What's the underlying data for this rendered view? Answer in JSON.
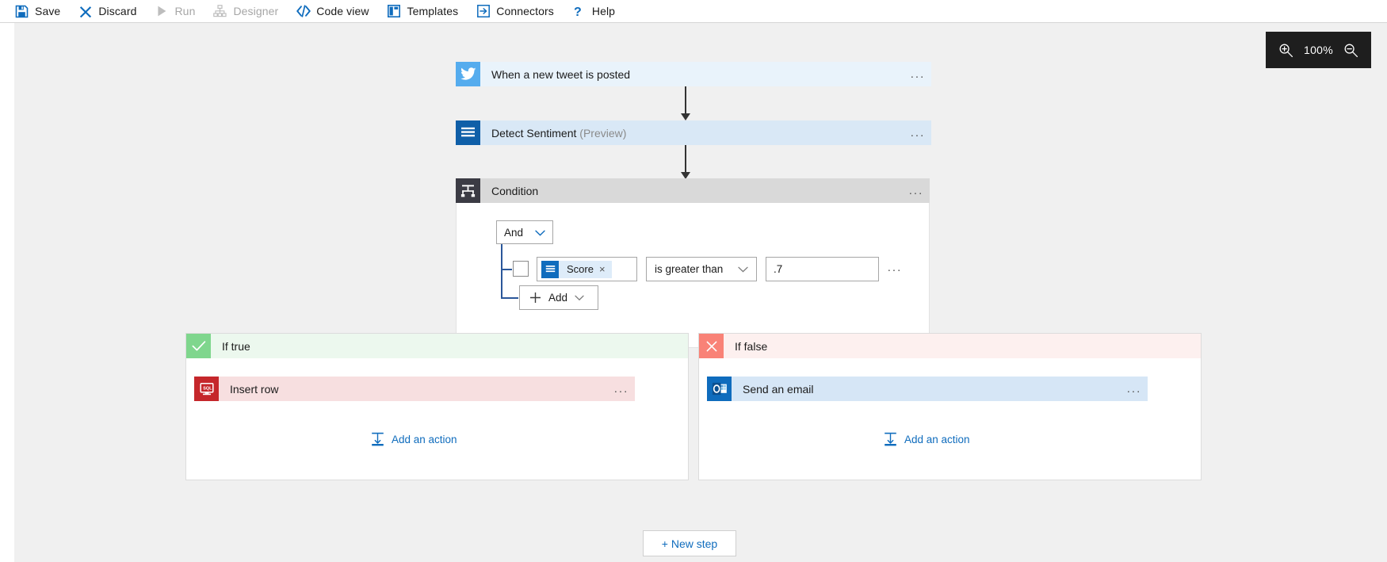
{
  "toolbar": {
    "items": [
      {
        "label": "Save",
        "icon": "save-icon",
        "disabled": false
      },
      {
        "label": "Discard",
        "icon": "discard-icon",
        "disabled": false
      },
      {
        "label": "Run",
        "icon": "run-icon",
        "disabled": true
      },
      {
        "label": "Designer",
        "icon": "designer-icon",
        "disabled": true
      },
      {
        "label": "Code view",
        "icon": "code-view-icon",
        "disabled": false
      },
      {
        "label": "Templates",
        "icon": "templates-icon",
        "disabled": false
      },
      {
        "label": "Connectors",
        "icon": "connectors-icon",
        "disabled": false
      },
      {
        "label": "Help",
        "icon": "help-icon",
        "disabled": false
      }
    ]
  },
  "zoom_control": {
    "zoom_in_icon": "zoom-in-icon",
    "level": "100%",
    "zoom_out_icon": "zoom-out-icon",
    "background": "#1e1e1e"
  },
  "flow": {
    "trigger": {
      "title": "When a new tweet is posted",
      "icon": "twitter-icon",
      "icon_color": "#55acee",
      "card_color": "#e9f3fb",
      "overflow": "..."
    },
    "action": {
      "title": "Detect Sentiment",
      "suffix": "(Preview)",
      "icon": "text-analytics-icon",
      "icon_color": "#0f5fa8",
      "card_color": "#d9e8f6",
      "overflow": "..."
    },
    "condition": {
      "title": "Condition",
      "icon": "condition-icon",
      "icon_color": "#3b3b44",
      "header_color": "#d9d9d9",
      "overflow": "...",
      "logic_operator": "And",
      "row": {
        "token_label": "Score",
        "token_icon": "text-analytics-token-icon",
        "token_remove": "×",
        "operator": "is greater than",
        "value": ".7",
        "row_overflow": "..."
      },
      "add_label": "Add"
    },
    "branches": [
      {
        "name": "if-true",
        "label": "If true",
        "tile_color": "#7fd68d",
        "header_color": "#ecf8ee",
        "status_icon": "check-icon",
        "action": {
          "title": "Insert row",
          "icon": "sql-icon",
          "icon_color": "#c5272b",
          "card_color": "#f7dfe0",
          "overflow": "..."
        },
        "add_action_label": "Add an action",
        "add_action_icon": "insert-action-icon"
      },
      {
        "name": "if-false",
        "label": "If false",
        "tile_color": "#f98277",
        "header_color": "#fdf0ef",
        "status_icon": "cross-icon",
        "action": {
          "title": "Send an email",
          "icon": "outlook-icon",
          "icon_color": "#0f6cbd",
          "card_color": "#d6e6f6",
          "overflow": "..."
        },
        "add_action_label": "Add an action",
        "add_action_icon": "insert-action-icon"
      }
    ],
    "new_step_label": "+ New step"
  }
}
